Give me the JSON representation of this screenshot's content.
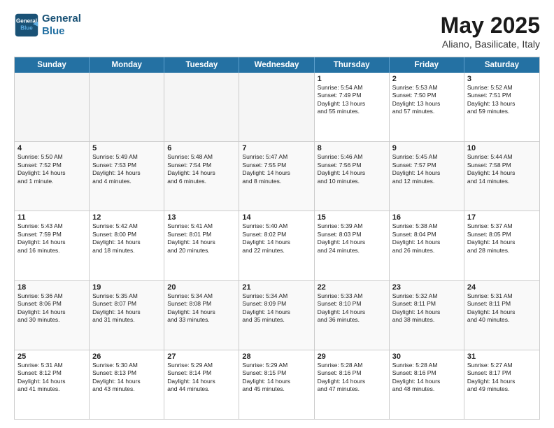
{
  "header": {
    "logo_line1": "General",
    "logo_line2": "Blue",
    "month": "May 2025",
    "location": "Aliano, Basilicate, Italy"
  },
  "weekdays": [
    "Sunday",
    "Monday",
    "Tuesday",
    "Wednesday",
    "Thursday",
    "Friday",
    "Saturday"
  ],
  "rows": [
    [
      {
        "day": "",
        "text": "",
        "empty": true
      },
      {
        "day": "",
        "text": "",
        "empty": true
      },
      {
        "day": "",
        "text": "",
        "empty": true
      },
      {
        "day": "",
        "text": "",
        "empty": true
      },
      {
        "day": "1",
        "text": "Sunrise: 5:54 AM\nSunset: 7:49 PM\nDaylight: 13 hours\nand 55 minutes."
      },
      {
        "day": "2",
        "text": "Sunrise: 5:53 AM\nSunset: 7:50 PM\nDaylight: 13 hours\nand 57 minutes."
      },
      {
        "day": "3",
        "text": "Sunrise: 5:52 AM\nSunset: 7:51 PM\nDaylight: 13 hours\nand 59 minutes."
      }
    ],
    [
      {
        "day": "4",
        "text": "Sunrise: 5:50 AM\nSunset: 7:52 PM\nDaylight: 14 hours\nand 1 minute."
      },
      {
        "day": "5",
        "text": "Sunrise: 5:49 AM\nSunset: 7:53 PM\nDaylight: 14 hours\nand 4 minutes."
      },
      {
        "day": "6",
        "text": "Sunrise: 5:48 AM\nSunset: 7:54 PM\nDaylight: 14 hours\nand 6 minutes."
      },
      {
        "day": "7",
        "text": "Sunrise: 5:47 AM\nSunset: 7:55 PM\nDaylight: 14 hours\nand 8 minutes."
      },
      {
        "day": "8",
        "text": "Sunrise: 5:46 AM\nSunset: 7:56 PM\nDaylight: 14 hours\nand 10 minutes."
      },
      {
        "day": "9",
        "text": "Sunrise: 5:45 AM\nSunset: 7:57 PM\nDaylight: 14 hours\nand 12 minutes."
      },
      {
        "day": "10",
        "text": "Sunrise: 5:44 AM\nSunset: 7:58 PM\nDaylight: 14 hours\nand 14 minutes."
      }
    ],
    [
      {
        "day": "11",
        "text": "Sunrise: 5:43 AM\nSunset: 7:59 PM\nDaylight: 14 hours\nand 16 minutes."
      },
      {
        "day": "12",
        "text": "Sunrise: 5:42 AM\nSunset: 8:00 PM\nDaylight: 14 hours\nand 18 minutes."
      },
      {
        "day": "13",
        "text": "Sunrise: 5:41 AM\nSunset: 8:01 PM\nDaylight: 14 hours\nand 20 minutes."
      },
      {
        "day": "14",
        "text": "Sunrise: 5:40 AM\nSunset: 8:02 PM\nDaylight: 14 hours\nand 22 minutes."
      },
      {
        "day": "15",
        "text": "Sunrise: 5:39 AM\nSunset: 8:03 PM\nDaylight: 14 hours\nand 24 minutes."
      },
      {
        "day": "16",
        "text": "Sunrise: 5:38 AM\nSunset: 8:04 PM\nDaylight: 14 hours\nand 26 minutes."
      },
      {
        "day": "17",
        "text": "Sunrise: 5:37 AM\nSunset: 8:05 PM\nDaylight: 14 hours\nand 28 minutes."
      }
    ],
    [
      {
        "day": "18",
        "text": "Sunrise: 5:36 AM\nSunset: 8:06 PM\nDaylight: 14 hours\nand 30 minutes."
      },
      {
        "day": "19",
        "text": "Sunrise: 5:35 AM\nSunset: 8:07 PM\nDaylight: 14 hours\nand 31 minutes."
      },
      {
        "day": "20",
        "text": "Sunrise: 5:34 AM\nSunset: 8:08 PM\nDaylight: 14 hours\nand 33 minutes."
      },
      {
        "day": "21",
        "text": "Sunrise: 5:34 AM\nSunset: 8:09 PM\nDaylight: 14 hours\nand 35 minutes."
      },
      {
        "day": "22",
        "text": "Sunrise: 5:33 AM\nSunset: 8:10 PM\nDaylight: 14 hours\nand 36 minutes."
      },
      {
        "day": "23",
        "text": "Sunrise: 5:32 AM\nSunset: 8:11 PM\nDaylight: 14 hours\nand 38 minutes."
      },
      {
        "day": "24",
        "text": "Sunrise: 5:31 AM\nSunset: 8:11 PM\nDaylight: 14 hours\nand 40 minutes."
      }
    ],
    [
      {
        "day": "25",
        "text": "Sunrise: 5:31 AM\nSunset: 8:12 PM\nDaylight: 14 hours\nand 41 minutes."
      },
      {
        "day": "26",
        "text": "Sunrise: 5:30 AM\nSunset: 8:13 PM\nDaylight: 14 hours\nand 43 minutes."
      },
      {
        "day": "27",
        "text": "Sunrise: 5:29 AM\nSunset: 8:14 PM\nDaylight: 14 hours\nand 44 minutes."
      },
      {
        "day": "28",
        "text": "Sunrise: 5:29 AM\nSunset: 8:15 PM\nDaylight: 14 hours\nand 45 minutes."
      },
      {
        "day": "29",
        "text": "Sunrise: 5:28 AM\nSunset: 8:16 PM\nDaylight: 14 hours\nand 47 minutes."
      },
      {
        "day": "30",
        "text": "Sunrise: 5:28 AM\nSunset: 8:16 PM\nDaylight: 14 hours\nand 48 minutes."
      },
      {
        "day": "31",
        "text": "Sunrise: 5:27 AM\nSunset: 8:17 PM\nDaylight: 14 hours\nand 49 minutes."
      }
    ]
  ]
}
